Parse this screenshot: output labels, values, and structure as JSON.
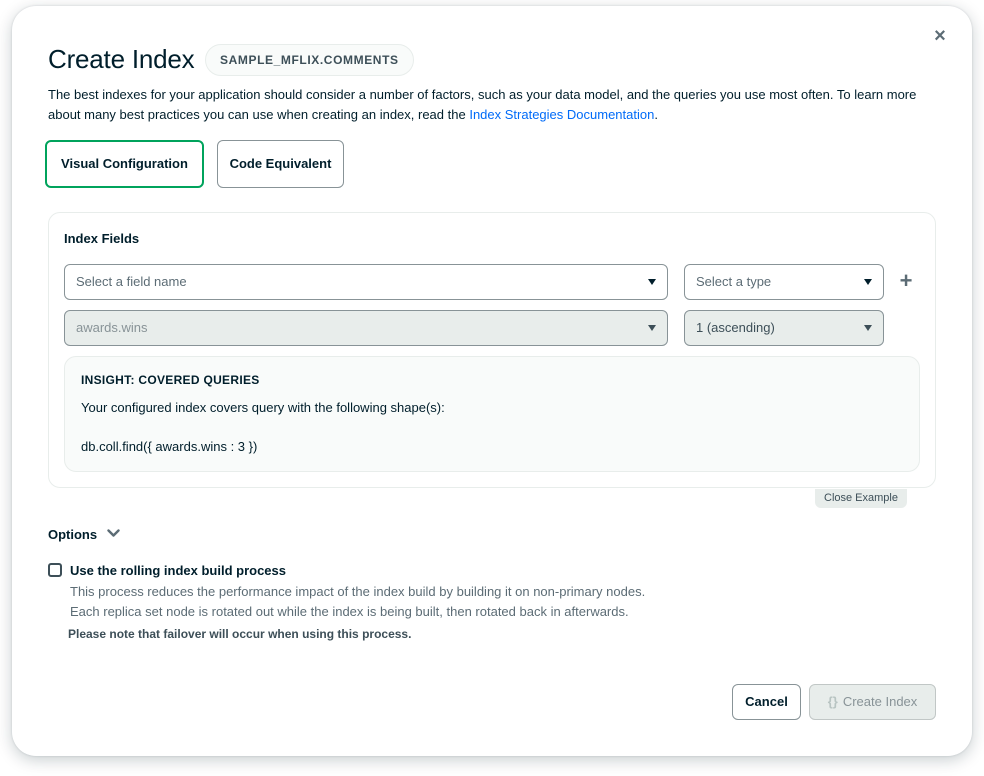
{
  "modal": {
    "close_glyph": "×",
    "title": "Create Index",
    "namespace": "SAMPLE_MFLIX.COMMENTS",
    "description_before_link": "The best indexes for your application should consider a number of factors, such as your data model, and the queries you use most often. To learn more about many best practices you can use when creating an index, read the ",
    "description_link": "Index Strategies Documentation",
    "description_after_link": "."
  },
  "tabs": [
    {
      "label": "Visual Configuration",
      "active": true
    },
    {
      "label": "Code Equivalent",
      "active": false
    }
  ],
  "index_fields": {
    "label": "Index Fields",
    "field_select_placeholder": "Select a field name",
    "type_select_placeholder": "Select a type",
    "add_glyph": "+",
    "example_field": "awards.wins",
    "example_type": "1 (ascending)"
  },
  "insight": {
    "title": "INSIGHT: COVERED QUERIES",
    "text": "Your configured index covers query with the following shape(s):",
    "code": "db.coll.find({ awards.wins : 3 })"
  },
  "close_example": "Close Example",
  "options": {
    "label": "Options",
    "rolling_label": "Use the rolling index build process",
    "rolling_desc_1": "This process reduces the performance impact of the index build by building it on non-primary nodes.",
    "rolling_desc_2": "Each replica set node is rotated out while the index is being built, then rotated back in afterwards.",
    "rolling_note": "Please note that failover will occur when using this process.",
    "rolling_checked": false
  },
  "footer": {
    "cancel_label": "Cancel",
    "create_icon": "{}",
    "create_label": "Create Index"
  },
  "colors": {
    "accent": "#00a35c",
    "link": "#016bf8",
    "text": "#001e2b",
    "muted": "#5c6c75"
  }
}
